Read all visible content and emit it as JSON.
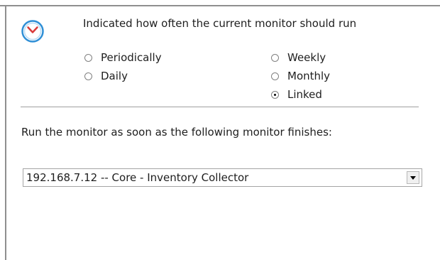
{
  "header": {
    "icon": "clock-icon",
    "text": "Indicated how often the current monitor should run"
  },
  "schedule_options": {
    "periodically": "Periodically",
    "daily": "Daily",
    "weekly": "Weekly",
    "monthly": "Monthly",
    "linked": "Linked",
    "selected": "Linked"
  },
  "linked": {
    "instruction": "Run the monitor as soon as the following monitor finishes:",
    "selected_monitor": "192.168.7.12 -- Core - Inventory Collector"
  },
  "colors": {
    "icon_accent": "#2f8fd6",
    "icon_hand": "#d93a3a"
  }
}
